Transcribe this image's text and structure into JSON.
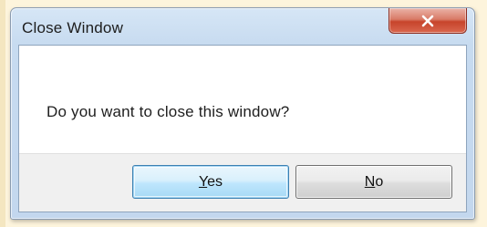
{
  "window": {
    "title": "Close Window",
    "close_icon": "close-x-icon",
    "message": "Do you want to close this window?"
  },
  "buttons": {
    "yes": {
      "mnemonic": "Y",
      "rest": "es"
    },
    "no": {
      "mnemonic": "N",
      "rest": "o"
    }
  },
  "colors": {
    "page_background": "#fdf4dc",
    "titlebar": "#c7dbf0",
    "close_button": "#c7442b",
    "default_button_border": "#3c7fb1",
    "button_border": "#707070"
  }
}
